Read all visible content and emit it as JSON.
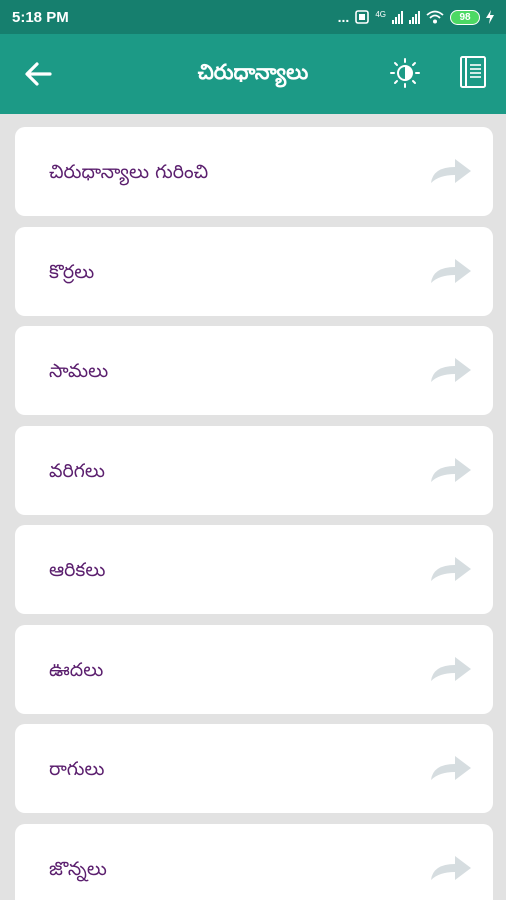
{
  "status_bar": {
    "time": "5:18 PM",
    "dots": "...",
    "network_label": "4G",
    "battery": "98"
  },
  "app_bar": {
    "title": "చిరుధాన్యాలు",
    "back_icon": "arrow-left-icon",
    "brightness_icon": "brightness-icon",
    "book_icon": "book-icon"
  },
  "items": [
    {
      "label": "చిరుధాన్యాలు గురించి"
    },
    {
      "label": "కొర్రలు"
    },
    {
      "label": "సామలు"
    },
    {
      "label": "వరిగలు"
    },
    {
      "label": "ఆరికలు"
    },
    {
      "label": "ఊదలు"
    },
    {
      "label": "రాగులు"
    },
    {
      "label": "జొన్నలు"
    }
  ],
  "colors": {
    "status_bar": "#167f6e",
    "app_bar": "#1c9a86",
    "background": "#e2e2e2",
    "label_text": "#5b1f6e",
    "arrow": "#d6dde0"
  }
}
